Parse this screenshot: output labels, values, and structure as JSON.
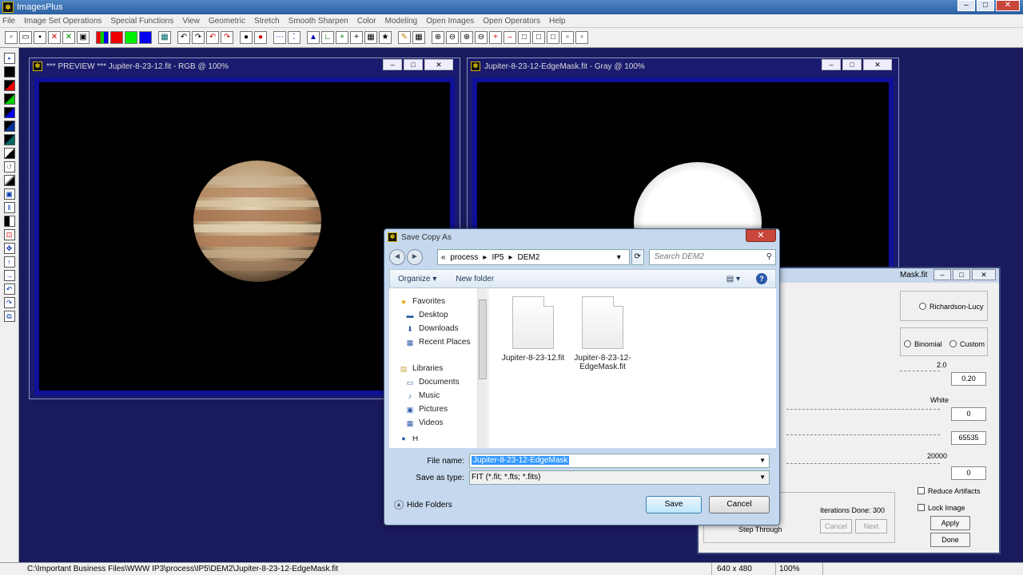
{
  "app": {
    "title": "ImagesPlus"
  },
  "menu": [
    "File",
    "Image Set Operations",
    "Special Functions",
    "View",
    "Geometric",
    "Stretch",
    "Smooth Sharpen",
    "Color",
    "Modeling",
    "Open Images",
    "Open Operators",
    "Help"
  ],
  "windows": {
    "preview": {
      "title": "*** PREVIEW *** Jupiter-8-23-12.fit - RGB @ 100%"
    },
    "mask": {
      "title": "Jupiter-8-23-12-EdgeMask.fit - Gray @ 100%"
    }
  },
  "dialog": {
    "title": "Save Copy As",
    "breadcrumb": [
      "«",
      "process",
      "IP5",
      "DEM2"
    ],
    "search_placeholder": "Search DEM2",
    "organize": "Organize",
    "new_folder": "New folder",
    "nav": {
      "favorites": "Favorites",
      "favorites_items": [
        "Desktop",
        "Downloads",
        "Recent Places"
      ],
      "libraries": "Libraries",
      "libraries_items": [
        "Documents",
        "Music",
        "Pictures",
        "Videos"
      ],
      "partial": "H"
    },
    "files": [
      "Jupiter-8-23-12.fit",
      "Jupiter-8-23-12-EdgeMask.fit"
    ],
    "file_name_label": "File name:",
    "file_name_value": "Jupiter-8-23-12-EdgeMask",
    "save_type_label": "Save as type:",
    "save_type_value": "FIT (*.fit; *.fts; *.fits)",
    "hide_folders": "Hide Folders",
    "save": "Save",
    "cancel": "Cancel"
  },
  "panel": {
    "title_fragment": "Mask.fit",
    "richardson": "Richardson-Lucy",
    "binomial": "Binomial",
    "custom": "Custom",
    "val_2_0": "2.0",
    "val_0_20": "0.20",
    "white": "White",
    "white_val": "0",
    "val_65535": "65535",
    "val_20000": "20000",
    "val_0": "0",
    "reduce_artifacts": "Reduce Artifacts",
    "lock_image": "Lock Image",
    "apply": "Apply",
    "done": "Done",
    "iterations": "Iterations Done:  300",
    "cancel": "Cancel",
    "next": "Next",
    "step_through": "Step Through"
  },
  "status": {
    "path": "C:\\Important Business Files\\WWW IP3\\process\\IP5\\DEM2\\Jupiter-8-23-12-EdgeMask.fit",
    "dims": "640 x 480",
    "zoom": "100%"
  },
  "colors": {
    "accent": "#3399ff",
    "window_bg": "#1a1a6e",
    "image_border": "#101098"
  }
}
